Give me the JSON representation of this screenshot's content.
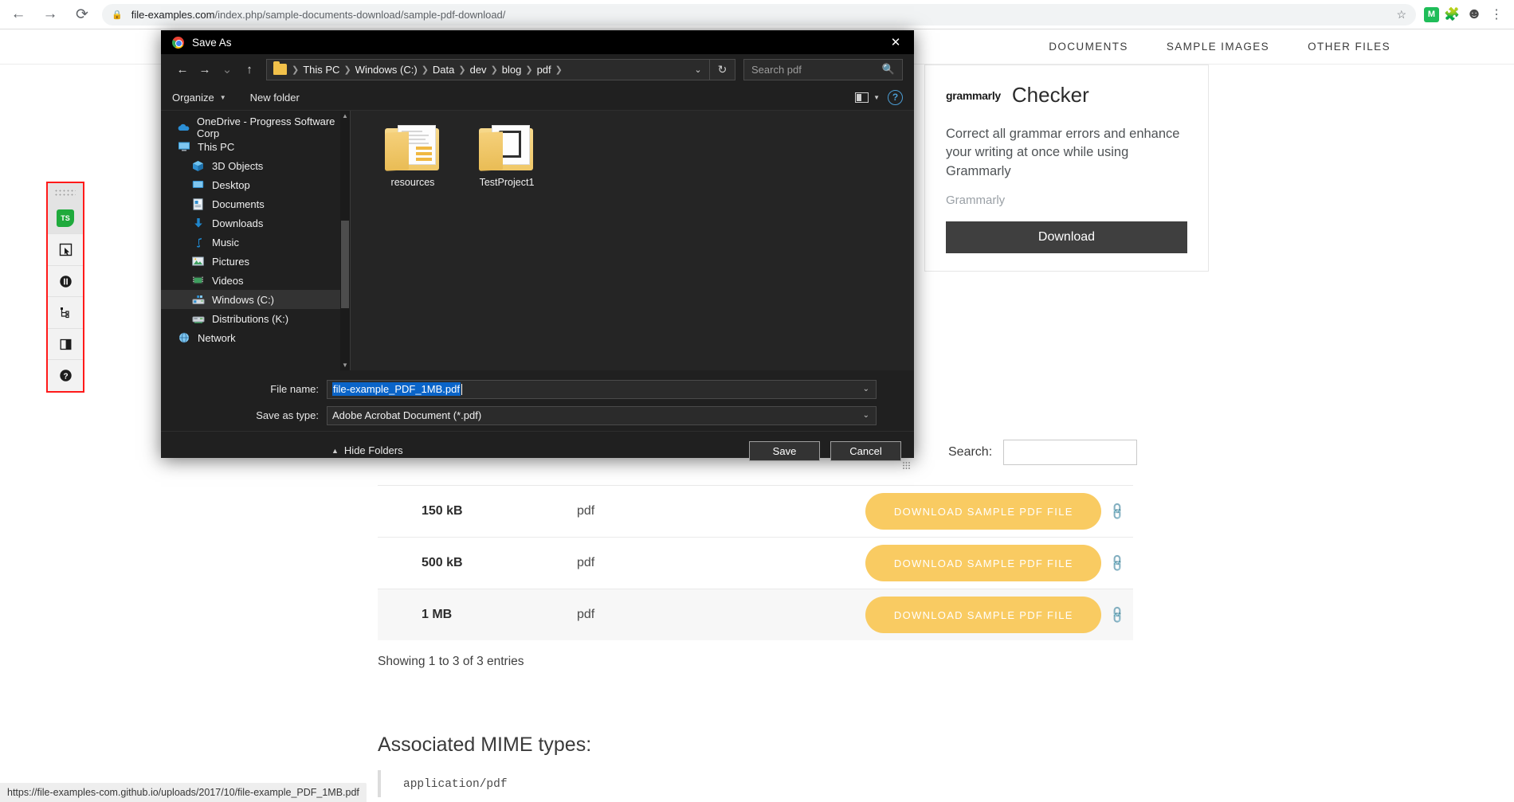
{
  "browser": {
    "back_icon": "back-arrow-icon",
    "forward_icon": "forward-arrow-icon",
    "reload_icon": "reload-icon",
    "lock_icon": "lock-icon",
    "url_domain": "file-examples.com",
    "url_path": "/index.php/sample-documents-download/sample-pdf-download/",
    "star_icon": "star-icon",
    "extension_badge": "M",
    "puzzle_icon": "extensions-puzzle-icon",
    "profile_icon": "profile-avatar-icon",
    "menu_icon": "kebab-menu-icon",
    "status_url": "https://file-examples-com.github.io/uploads/2017/10/file-example_PDF_1MB.pdf"
  },
  "site": {
    "nav_items": [
      {
        "label": "DOCUMENTS"
      },
      {
        "label": "SAMPLE IMAGES"
      },
      {
        "label": "OTHER FILES"
      }
    ],
    "ad": {
      "logo": "grammarly",
      "title": "Checker",
      "body": "Correct all grammar errors and enhance your writing at once while using Grammarly",
      "source": "Grammarly",
      "button": "Download"
    },
    "search": {
      "label": "Search:",
      "value": "",
      "placeholder": ""
    },
    "table": {
      "rows": [
        {
          "size": "150 kB",
          "type": "pdf",
          "action": "DOWNLOAD SAMPLE PDF FILE"
        },
        {
          "size": "500 kB",
          "type": "pdf",
          "action": "DOWNLOAD SAMPLE PDF FILE"
        },
        {
          "size": "1 MB",
          "type": "pdf",
          "action": "DOWNLOAD SAMPLE PDF FILE"
        }
      ],
      "showing": "Showing 1 to 3 of 3 entries"
    },
    "mime": {
      "title": "Associated MIME types:",
      "value": "application/pdf"
    }
  },
  "left_toolbar": {
    "grip": "drag-grip",
    "items": [
      {
        "icon": "testing-studio-ts-icon",
        "label": "TS"
      },
      {
        "icon": "element-picker-icon"
      },
      {
        "icon": "pause-circle-icon"
      },
      {
        "icon": "dom-tree-icon"
      },
      {
        "icon": "split-panel-icon"
      },
      {
        "icon": "help-circle-icon"
      }
    ]
  },
  "dialog": {
    "title": "Save As",
    "close_icon": "close-icon",
    "nav": {
      "back_icon": "back-arrow-icon",
      "forward_icon": "forward-arrow-icon",
      "recent_icon": "recent-locations-chevron-icon",
      "up_icon": "up-arrow-icon"
    },
    "breadcrumb": {
      "folder_icon": "folder-icon",
      "items": [
        "This PC",
        "Windows (C:)",
        "Data",
        "dev",
        "blog",
        "pdf"
      ],
      "chevron_icon": "chevron-down-icon",
      "refresh_icon": "refresh-icon"
    },
    "search": {
      "placeholder": "Search pdf",
      "value": "",
      "icon": "magnifier-icon"
    },
    "toolbar": {
      "organize": "Organize",
      "organize_caret": "caret-down-icon",
      "new_folder": "New folder",
      "view_icon": "view-layout-icon",
      "view_caret": "caret-down-icon",
      "help_icon": "help-icon"
    },
    "tree": [
      {
        "label": "OneDrive - Progress Software Corp",
        "icon": "onedrive-cloud-icon",
        "indent": false,
        "selected": false
      },
      {
        "label": "This PC",
        "icon": "this-pc-monitor-icon",
        "indent": false,
        "selected": false
      },
      {
        "label": "3D Objects",
        "icon": "3d-objects-icon",
        "indent": true,
        "selected": false
      },
      {
        "label": "Desktop",
        "icon": "desktop-icon",
        "indent": true,
        "selected": false
      },
      {
        "label": "Documents",
        "icon": "documents-icon",
        "indent": true,
        "selected": false
      },
      {
        "label": "Downloads",
        "icon": "downloads-arrow-icon",
        "indent": true,
        "selected": false
      },
      {
        "label": "Music",
        "icon": "music-note-icon",
        "indent": true,
        "selected": false
      },
      {
        "label": "Pictures",
        "icon": "pictures-icon",
        "indent": true,
        "selected": false
      },
      {
        "label": "Videos",
        "icon": "videos-icon",
        "indent": true,
        "selected": false
      },
      {
        "label": "Windows (C:)",
        "icon": "hard-drive-icon",
        "indent": true,
        "selected": true
      },
      {
        "label": "Distributions (K:)",
        "icon": "network-drive-icon",
        "indent": true,
        "selected": false
      },
      {
        "label": "Network",
        "icon": "network-icon",
        "indent": false,
        "selected": false
      }
    ],
    "files": [
      {
        "name": "resources",
        "icon": "folder-with-document-icon"
      },
      {
        "name": "TestProject1",
        "icon": "folder-with-files-icon"
      }
    ],
    "fields": {
      "file_name_label": "File name:",
      "file_name_value": "file-example_PDF_1MB.pdf",
      "save_type_label": "Save as type:",
      "save_type_value": "Adobe Acrobat Document (*.pdf)",
      "chevron_icon": "chevron-down-icon"
    },
    "footer": {
      "hide_folders": "Hide Folders",
      "hide_caret": "caret-up-icon",
      "save": "Save",
      "cancel": "Cancel"
    }
  },
  "colors": {
    "accent_yellow": "#f9cb62",
    "selection_blue": "#0a64c8",
    "dialog_bg": "#202020",
    "toolbar_red": "#ff1a1a"
  }
}
